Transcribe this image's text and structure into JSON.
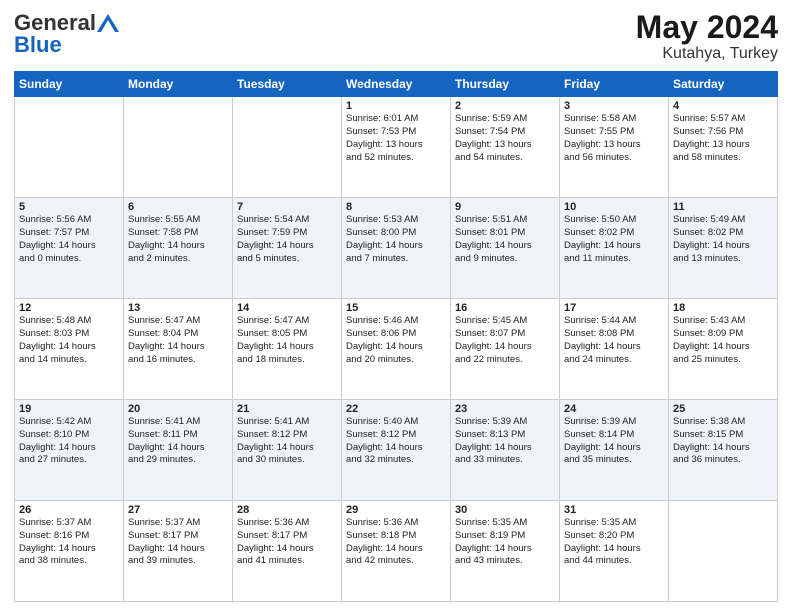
{
  "header": {
    "logo_general": "General",
    "logo_blue": "Blue",
    "title": "May 2024",
    "location": "Kutahya, Turkey"
  },
  "days_of_week": [
    "Sunday",
    "Monday",
    "Tuesday",
    "Wednesday",
    "Thursday",
    "Friday",
    "Saturday"
  ],
  "weeks": [
    [
      {
        "day": "",
        "info": ""
      },
      {
        "day": "",
        "info": ""
      },
      {
        "day": "",
        "info": ""
      },
      {
        "day": "1",
        "info": "Sunrise: 6:01 AM\nSunset: 7:53 PM\nDaylight: 13 hours\nand 52 minutes."
      },
      {
        "day": "2",
        "info": "Sunrise: 5:59 AM\nSunset: 7:54 PM\nDaylight: 13 hours\nand 54 minutes."
      },
      {
        "day": "3",
        "info": "Sunrise: 5:58 AM\nSunset: 7:55 PM\nDaylight: 13 hours\nand 56 minutes."
      },
      {
        "day": "4",
        "info": "Sunrise: 5:57 AM\nSunset: 7:56 PM\nDaylight: 13 hours\nand 58 minutes."
      }
    ],
    [
      {
        "day": "5",
        "info": "Sunrise: 5:56 AM\nSunset: 7:57 PM\nDaylight: 14 hours\nand 0 minutes."
      },
      {
        "day": "6",
        "info": "Sunrise: 5:55 AM\nSunset: 7:58 PM\nDaylight: 14 hours\nand 2 minutes."
      },
      {
        "day": "7",
        "info": "Sunrise: 5:54 AM\nSunset: 7:59 PM\nDaylight: 14 hours\nand 5 minutes."
      },
      {
        "day": "8",
        "info": "Sunrise: 5:53 AM\nSunset: 8:00 PM\nDaylight: 14 hours\nand 7 minutes."
      },
      {
        "day": "9",
        "info": "Sunrise: 5:51 AM\nSunset: 8:01 PM\nDaylight: 14 hours\nand 9 minutes."
      },
      {
        "day": "10",
        "info": "Sunrise: 5:50 AM\nSunset: 8:02 PM\nDaylight: 14 hours\nand 11 minutes."
      },
      {
        "day": "11",
        "info": "Sunrise: 5:49 AM\nSunset: 8:02 PM\nDaylight: 14 hours\nand 13 minutes."
      }
    ],
    [
      {
        "day": "12",
        "info": "Sunrise: 5:48 AM\nSunset: 8:03 PM\nDaylight: 14 hours\nand 14 minutes."
      },
      {
        "day": "13",
        "info": "Sunrise: 5:47 AM\nSunset: 8:04 PM\nDaylight: 14 hours\nand 16 minutes."
      },
      {
        "day": "14",
        "info": "Sunrise: 5:47 AM\nSunset: 8:05 PM\nDaylight: 14 hours\nand 18 minutes."
      },
      {
        "day": "15",
        "info": "Sunrise: 5:46 AM\nSunset: 8:06 PM\nDaylight: 14 hours\nand 20 minutes."
      },
      {
        "day": "16",
        "info": "Sunrise: 5:45 AM\nSunset: 8:07 PM\nDaylight: 14 hours\nand 22 minutes."
      },
      {
        "day": "17",
        "info": "Sunrise: 5:44 AM\nSunset: 8:08 PM\nDaylight: 14 hours\nand 24 minutes."
      },
      {
        "day": "18",
        "info": "Sunrise: 5:43 AM\nSunset: 8:09 PM\nDaylight: 14 hours\nand 25 minutes."
      }
    ],
    [
      {
        "day": "19",
        "info": "Sunrise: 5:42 AM\nSunset: 8:10 PM\nDaylight: 14 hours\nand 27 minutes."
      },
      {
        "day": "20",
        "info": "Sunrise: 5:41 AM\nSunset: 8:11 PM\nDaylight: 14 hours\nand 29 minutes."
      },
      {
        "day": "21",
        "info": "Sunrise: 5:41 AM\nSunset: 8:12 PM\nDaylight: 14 hours\nand 30 minutes."
      },
      {
        "day": "22",
        "info": "Sunrise: 5:40 AM\nSunset: 8:12 PM\nDaylight: 14 hours\nand 32 minutes."
      },
      {
        "day": "23",
        "info": "Sunrise: 5:39 AM\nSunset: 8:13 PM\nDaylight: 14 hours\nand 33 minutes."
      },
      {
        "day": "24",
        "info": "Sunrise: 5:39 AM\nSunset: 8:14 PM\nDaylight: 14 hours\nand 35 minutes."
      },
      {
        "day": "25",
        "info": "Sunrise: 5:38 AM\nSunset: 8:15 PM\nDaylight: 14 hours\nand 36 minutes."
      }
    ],
    [
      {
        "day": "26",
        "info": "Sunrise: 5:37 AM\nSunset: 8:16 PM\nDaylight: 14 hours\nand 38 minutes."
      },
      {
        "day": "27",
        "info": "Sunrise: 5:37 AM\nSunset: 8:17 PM\nDaylight: 14 hours\nand 39 minutes."
      },
      {
        "day": "28",
        "info": "Sunrise: 5:36 AM\nSunset: 8:17 PM\nDaylight: 14 hours\nand 41 minutes."
      },
      {
        "day": "29",
        "info": "Sunrise: 5:36 AM\nSunset: 8:18 PM\nDaylight: 14 hours\nand 42 minutes."
      },
      {
        "day": "30",
        "info": "Sunrise: 5:35 AM\nSunset: 8:19 PM\nDaylight: 14 hours\nand 43 minutes."
      },
      {
        "day": "31",
        "info": "Sunrise: 5:35 AM\nSunset: 8:20 PM\nDaylight: 14 hours\nand 44 minutes."
      },
      {
        "day": "",
        "info": ""
      }
    ]
  ]
}
